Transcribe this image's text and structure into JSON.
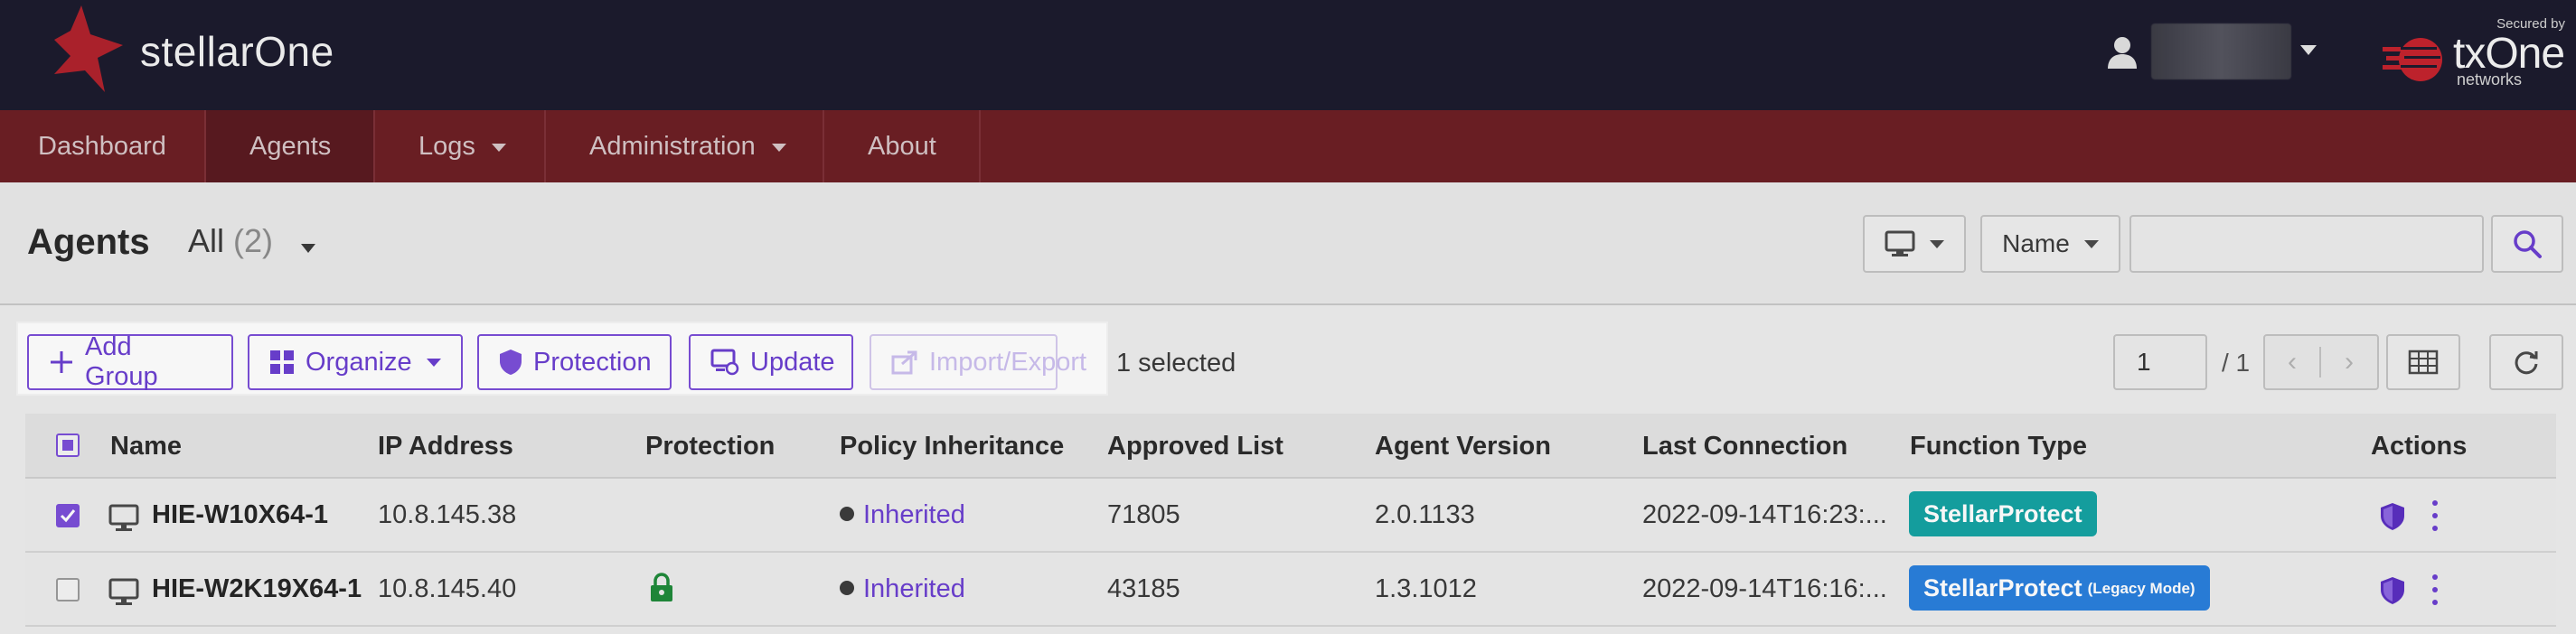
{
  "app": {
    "name": "stellarOne",
    "secured_by": "Secured by",
    "vendor_word": "txOne",
    "vendor_sub": "networks",
    "accent": "#7b4fd8",
    "nav_color": "#6d1f25",
    "header_color": "#1c1b2e"
  },
  "nav": {
    "dashboard": "Dashboard",
    "agents": "Agents",
    "logs": "Logs",
    "administration": "Administration",
    "about": "About"
  },
  "page": {
    "title": "Agents",
    "filter_label": "All",
    "filter_count": "(2)",
    "search_field_label": "Name",
    "search_placeholder": ""
  },
  "toolbar": {
    "add_group": "Add Group",
    "organize": "Organize",
    "protection": "Protection",
    "update": "Update",
    "import_export": "Import/Export",
    "selected": "1 selected",
    "page_current": "1",
    "page_total": "/ 1"
  },
  "table": {
    "headers": {
      "name": "Name",
      "ip": "IP Address",
      "protection": "Protection",
      "policy": "Policy Inheritance",
      "approved": "Approved List",
      "version": "Agent Version",
      "last": "Last Connection",
      "function": "Function Type",
      "actions": "Actions"
    },
    "rows": [
      {
        "checked": true,
        "name": "HIE-W10X64-1",
        "ip": "10.8.145.38",
        "protection_locked": false,
        "policy": "Inherited",
        "approved": "71805",
        "version": "2.0.1133",
        "last": "2022-09-14T16:23:...",
        "function": "StellarProtect",
        "function_suffix": "",
        "function_color": "#15a3a3"
      },
      {
        "checked": false,
        "name": "HIE-W2K19X64-1",
        "ip": "10.8.145.40",
        "protection_locked": true,
        "policy": "Inherited",
        "approved": "43185",
        "version": "1.3.1012",
        "last": "2022-09-14T16:16:...",
        "function": "StellarProtect",
        "function_suffix": "(Legacy Mode)",
        "function_color": "#2a7fdc"
      }
    ]
  }
}
